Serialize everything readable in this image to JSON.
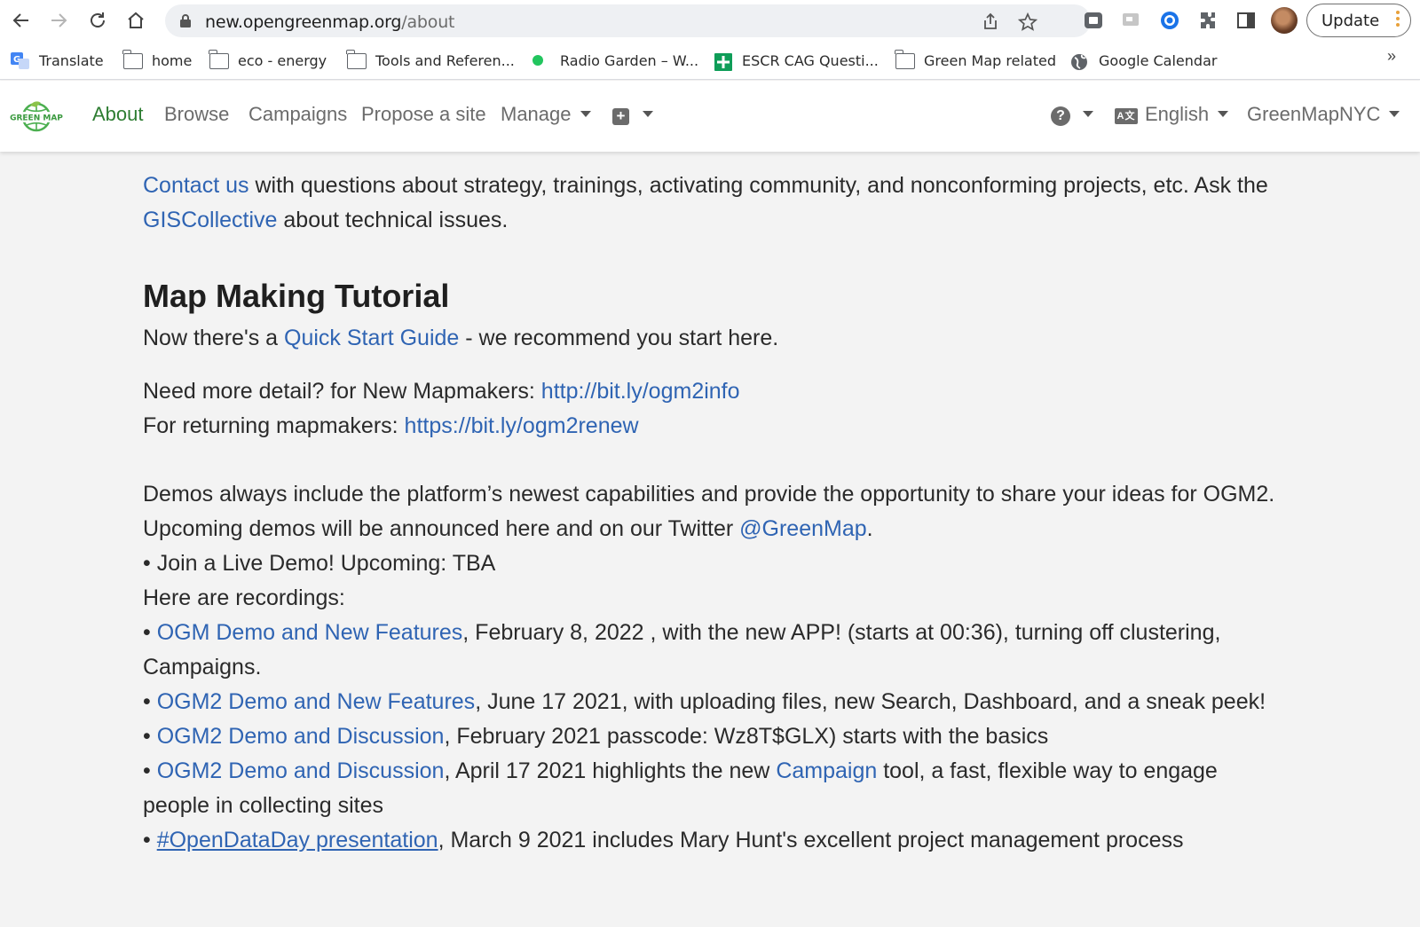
{
  "browser": {
    "url_host": "new.opengreenmap.org",
    "url_path": "/about",
    "update_label": "Update",
    "bookmarks": [
      {
        "label": "Translate",
        "icon": "translate-icon"
      },
      {
        "label": "home",
        "icon": "folder-icon"
      },
      {
        "label": "eco - energy",
        "icon": "folder-icon"
      },
      {
        "label": "Tools and Referen...",
        "icon": "folder-icon"
      },
      {
        "label": "Radio Garden – W...",
        "icon": "green-dot-icon"
      },
      {
        "label": "ESCR CAG Questi...",
        "icon": "sheets-icon"
      },
      {
        "label": "Green Map related",
        "icon": "folder-icon"
      },
      {
        "label": "Google Calendar",
        "icon": "globe-icon"
      }
    ],
    "bookmarks_more": "»"
  },
  "nav": {
    "logo_text": "GREEN MAP",
    "links": [
      "About",
      "Browse",
      "Campaigns",
      "Propose a site",
      "Manage"
    ],
    "language": "English",
    "language_icon_text": "A文",
    "account": "GreenMapNYC",
    "help_icon_text": "?"
  },
  "content": {
    "intro_link1": "Contact us",
    "intro_text1": " with questions about strategy, trainings, activating community, and nonconforming projects, etc. Ask the ",
    "intro_link2": "GISCollective",
    "intro_text2": " about technical issues.",
    "heading": "Map Making Tutorial",
    "qs_pre": "Now there's a ",
    "qs_link": "Quick Start Guide",
    "qs_post": " - we recommend you start here.",
    "new_pre": "Need more detail? for New Mapmakers: ",
    "new_link": "http://bit.ly/ogm2info",
    "ret_pre": "For returning mapmakers: ",
    "ret_link": "https://bit.ly/ogm2renew",
    "demos_text": "Demos always include the platform’s newest capabilities and provide the opportunity to share your ideas for OGM2.",
    "upcoming_pre": "Upcoming demos will be announced here and on our Twitter ",
    "upcoming_link": "@GreenMap",
    "upcoming_post": ".",
    "live_demo": "• Join a Live Demo! Upcoming: TBA",
    "recordings": "Here are recordings:",
    "bullet": "• ",
    "rec1_link": "OGM Demo and New Features",
    "rec1_text": ", February 8, 2022 , with the new APP! (starts at 00:36), turning off clustering, Campaigns.",
    "rec2_link": "OGM2 Demo and New Features",
    "rec2_text": ", June 17 2021, with uploading files, new Search, Dashboard, and a sneak peek!",
    "rec3_link": "OGM2 Demo and Discussion",
    "rec3_text": ", February 2021 passcode: Wz8T$GLX) starts with the basics",
    "rec4_link": "OGM2 Demo and Discussion",
    "rec4_text1": ", April 17 2021 highlights the new ",
    "rec4_link2": "Campaign",
    "rec4_text2": " tool, a fast, flexible way to engage people in collecting sites",
    "rec5_link": "#OpenDataDay presentation",
    "rec5_text": ", March 9 2021 includes Mary Hunt's excellent project management process"
  }
}
